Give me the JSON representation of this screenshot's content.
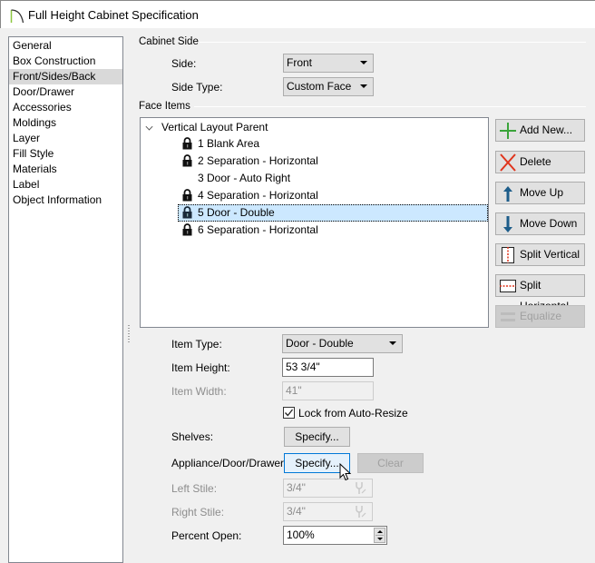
{
  "window": {
    "title": "Full Height Cabinet Specification",
    "icon": "cabinet-arc-icon"
  },
  "nav": {
    "items": [
      {
        "label": "General",
        "selected": false
      },
      {
        "label": "Box Construction",
        "selected": false
      },
      {
        "label": "Front/Sides/Back",
        "selected": true
      },
      {
        "label": "Door/Drawer",
        "selected": false
      },
      {
        "label": "Accessories",
        "selected": false
      },
      {
        "label": "Moldings",
        "selected": false
      },
      {
        "label": "Layer",
        "selected": false
      },
      {
        "label": "Fill Style",
        "selected": false
      },
      {
        "label": "Materials",
        "selected": false
      },
      {
        "label": "Label",
        "selected": false
      },
      {
        "label": "Object Information",
        "selected": false
      }
    ]
  },
  "cabinet_side": {
    "group_label": "Cabinet Side",
    "side_label": "Side:",
    "side_value": "Front",
    "side_type_label": "Side Type:",
    "side_type_value": "Custom Face"
  },
  "face_items": {
    "group_label": "Face Items",
    "parent": "Vertical Layout Parent",
    "items": [
      {
        "label": "1 Blank Area",
        "locked": true,
        "selected": false
      },
      {
        "label": "2 Separation - Horizontal",
        "locked": true,
        "selected": false
      },
      {
        "label": "3 Door - Auto Right",
        "locked": false,
        "selected": false
      },
      {
        "label": "4 Separation - Horizontal",
        "locked": true,
        "selected": false
      },
      {
        "label": "5 Door - Double",
        "locked": true,
        "selected": true
      },
      {
        "label": "6 Separation - Horizontal",
        "locked": true,
        "selected": false
      }
    ]
  },
  "actions": {
    "add_new": "Add New...",
    "delete": "Delete",
    "move_up": "Move Up",
    "move_down": "Move Down",
    "split_vertical": "Split Vertical",
    "split_horizontal": "Split Horizontal",
    "equalize": "Equalize"
  },
  "item": {
    "type_label": "Item Type:",
    "type_value": "Door - Double",
    "height_label": "Item Height:",
    "height_value": "53 3/4\"",
    "width_label": "Item Width:",
    "width_value": "41\"",
    "lock_label": "Lock from Auto-Resize",
    "lock_checked": true,
    "shelves_label": "Shelves:",
    "shelves_button": "Specify...",
    "appliance_label": "Appliance/Door/Drawer:",
    "appliance_button": "Specify...",
    "clear_button": "Clear",
    "left_stile_label": "Left Stile:",
    "left_stile_value": "3/4\"",
    "right_stile_label": "Right Stile:",
    "right_stile_value": "3/4\"",
    "percent_open_label": "Percent Open:",
    "percent_open_value": "100%"
  },
  "colors": {
    "selection": "#cce8ff",
    "add_green": "#3aa43a",
    "delete_red": "#e0341c",
    "arrow_blue": "#1d5d8a",
    "split_red": "#e0341c"
  }
}
